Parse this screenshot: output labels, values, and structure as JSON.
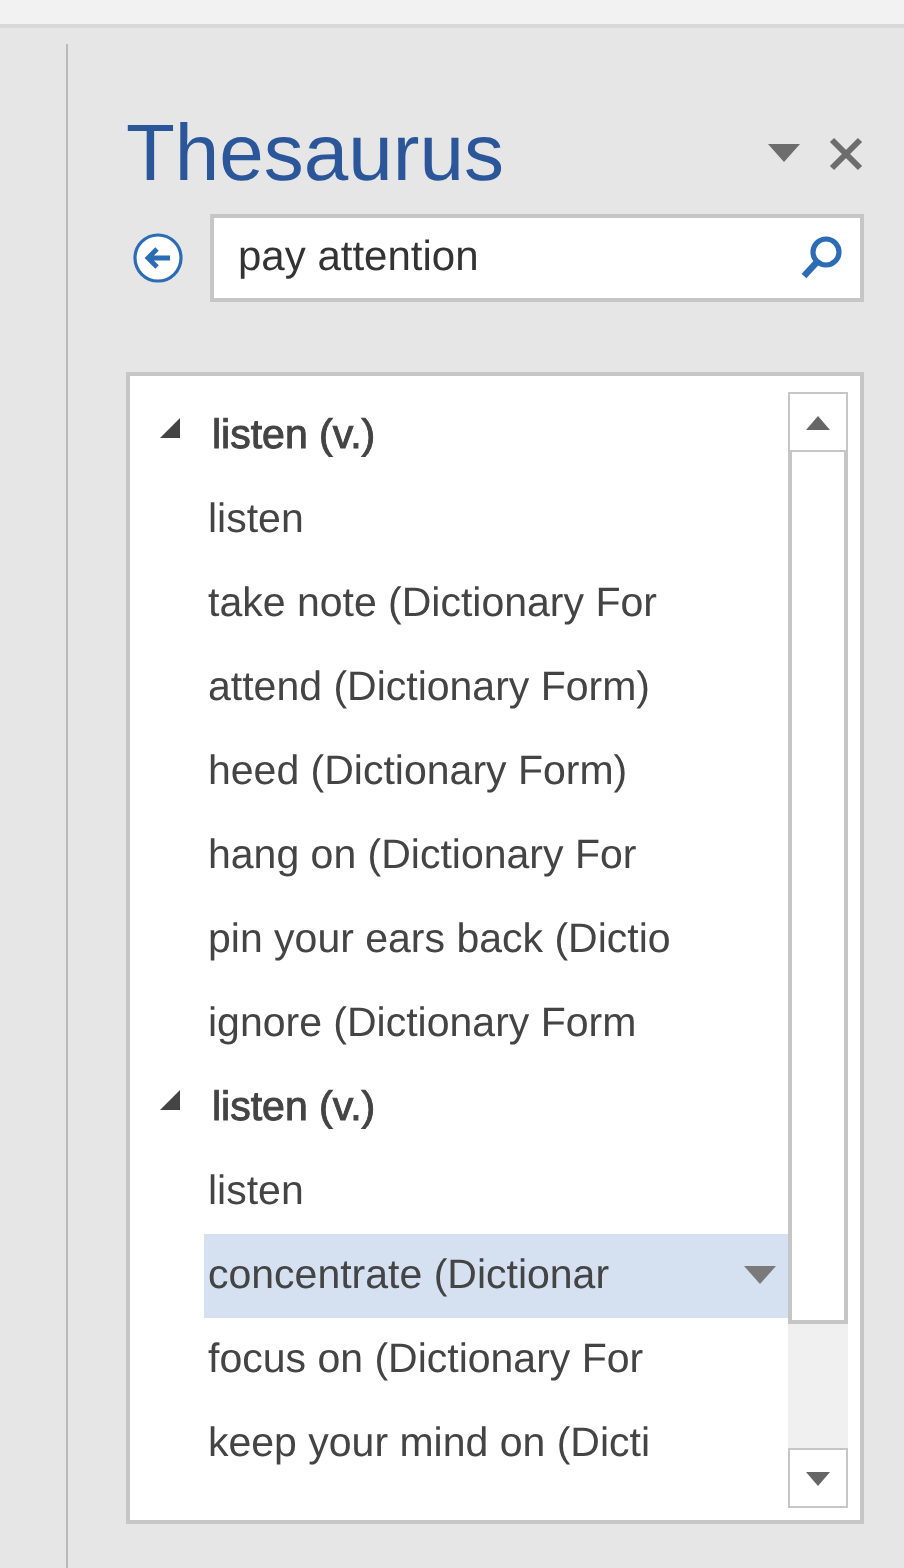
{
  "pane": {
    "title": "Thesaurus"
  },
  "search": {
    "value": "pay attention"
  },
  "results": [
    {
      "label": "listen (v.)",
      "expanded": true,
      "children": [
        {
          "label": "listen",
          "selected": false
        },
        {
          "label": "take note (Dictionary For",
          "selected": false
        },
        {
          "label": "attend (Dictionary Form)",
          "selected": false
        },
        {
          "label": "heed (Dictionary Form)",
          "selected": false
        },
        {
          "label": "hang on (Dictionary For",
          "selected": false
        },
        {
          "label": "pin your ears back (Dictio",
          "selected": false
        },
        {
          "label": "ignore (Dictionary Form",
          "selected": false
        }
      ]
    },
    {
      "label": "listen (v.)",
      "expanded": true,
      "children": [
        {
          "label": "listen",
          "selected": false
        },
        {
          "label": "concentrate (Dictionar",
          "selected": true
        },
        {
          "label": "focus on (Dictionary For",
          "selected": false
        },
        {
          "label": "keep your mind on (Dicti",
          "selected": false
        }
      ]
    }
  ]
}
